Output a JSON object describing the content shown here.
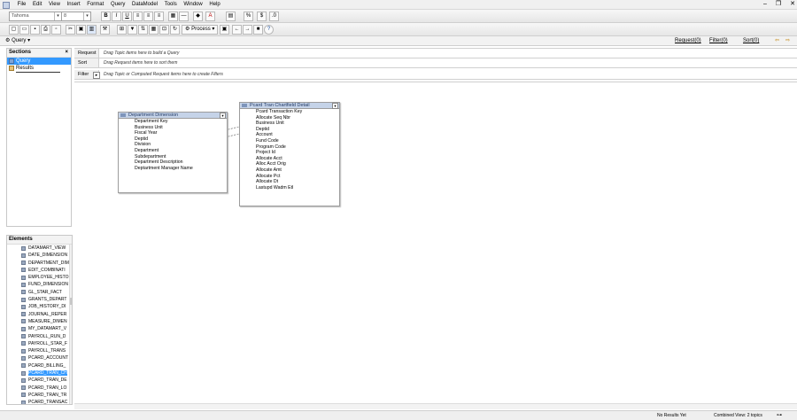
{
  "menu": [
    "File",
    "Edit",
    "View",
    "Insert",
    "Format",
    "Query",
    "DataModel",
    "Tools",
    "Window",
    "Help"
  ],
  "toolbar": {
    "font_name": "Tahoma",
    "font_size": "8",
    "bold": "B",
    "italic": "I",
    "underline": "U",
    "font_color": "A",
    "process_label": "Process",
    "help": "?"
  },
  "section_bar": {
    "selected_section": "Query",
    "request_link": "Request(0)",
    "filters_link": "Filter(0)",
    "sort_link": "Sort(0)"
  },
  "sections_pane": {
    "title": "Sections",
    "close": "×",
    "items": [
      {
        "label": "Query",
        "selected": true
      },
      {
        "label": "Results",
        "selected": false
      }
    ]
  },
  "elements_pane": {
    "title": "Elements",
    "items": [
      "DATAMART_VIEW",
      "DATE_DIMENSION",
      "DEPARTMENT_DIM",
      "EDIT_COMBINATI",
      "EMPLOYEE_HISTO",
      "FUND_DIMENSION",
      "GL_STAR_FACT",
      "GRANTS_DEPART",
      "JOB_HISTORY_DI",
      "JOURNAL_REPER",
      "MEASURE_DIMEN",
      "MY_DATAMART_V",
      "PAYROLL_RUN_D",
      "PAYROLL_STAR_F",
      "PAYROLL_TRANS",
      "PCARD_ACCOUNT",
      "PCARD_BILLING_",
      "PCARD_TRAN_CH",
      "PCARD_TRAN_DE",
      "PCARD_TRAN_LO",
      "PCARD_TRAN_TR",
      "PCARD_TRANSAC"
    ],
    "selected_index": 17
  },
  "request_area": {
    "request_label": "Request",
    "request_hint": "Drag Topic items here to build a Query",
    "sort_label": "Sort",
    "sort_hint": "Drag Request items here to sort them",
    "filter_label": "Filter",
    "filter_hint": "Drag Topic or Computed Request items here to create Filters"
  },
  "topics": [
    {
      "title": "Department Dimension",
      "items": [
        "Department Key",
        "Business Unit",
        "Fiscal Year",
        "Deptid",
        "Division",
        "Department",
        "Subdepartment",
        "Department Description",
        "Deptartment Manager Name"
      ]
    },
    {
      "title": "Pcard Tran Chartfield Detail",
      "items": [
        "Pcard Transaction Key",
        "Allocate Seq Nbr",
        "Business Unit",
        "Deptid",
        "Account",
        "Fund Code",
        "Program Code",
        "Project Id",
        "Allocate Acct",
        "Alloc Acct Orig",
        "Allocate Amt",
        "Allocate Pct",
        "Allocate Dt",
        "Lastupd Wadm Etl"
      ]
    }
  ],
  "status": {
    "results": "No Results Yet",
    "view": "Combined View: 2 topics"
  }
}
